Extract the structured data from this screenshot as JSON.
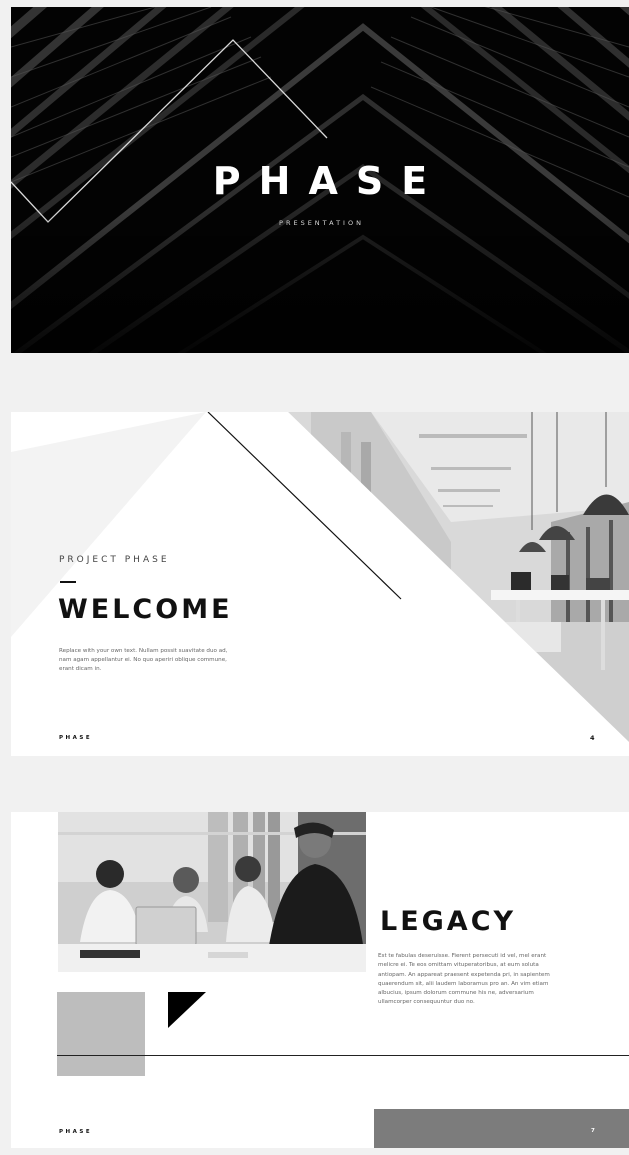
{
  "slides": [
    {
      "title": "PHASE",
      "subtitle": "PRESENTATION"
    },
    {
      "eyebrow": "PROJECT PHASE",
      "title": "WELCOME",
      "body": "Replace with your own text. Nullam possit suavitate duo ad, nam agam appellantur ei. No quo aperiri oblique commune, erant dicam in.",
      "brand": "PHASE",
      "page_number": "4",
      "image": "office-interior-photo"
    },
    {
      "title": "LEGACY",
      "body": "Est te fabulas deseruisse. Fierent persecuti id vel, mel erant melicre ei. Te eos omittam vituperatoribus, at eum soluta antiopam. An appareat praesent expetenda pri, in sapientem quaerendum sit, alii laudem laboramus pro an. An vim etiam albucius, ipsum dolorum commune his ne, adversarium ullamcorper consequuntur duo no.",
      "brand": "PHASE",
      "page_number": "7",
      "image": "business-team-photo"
    }
  ],
  "colors": {
    "background": "#f1f1f1",
    "slide_dark": "#000000",
    "text_dark": "#111111",
    "gray_box": "#bdbdbd",
    "dark_gray_box": "#7c7c7c"
  }
}
